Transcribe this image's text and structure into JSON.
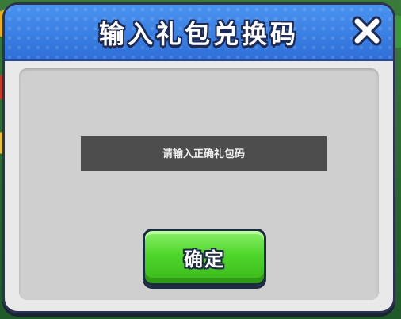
{
  "dialog": {
    "title": "输入礼包兑换码",
    "close_icon": "close-x-icon",
    "header_color": "#3a80e6",
    "panel_color": "#cfcfcf"
  },
  "redeem": {
    "input_value": "",
    "placeholder": "请输入正确礼包码",
    "input_bg": "#4d4d4d"
  },
  "confirm_button": {
    "label": "确定",
    "color": "#4fd62a"
  }
}
